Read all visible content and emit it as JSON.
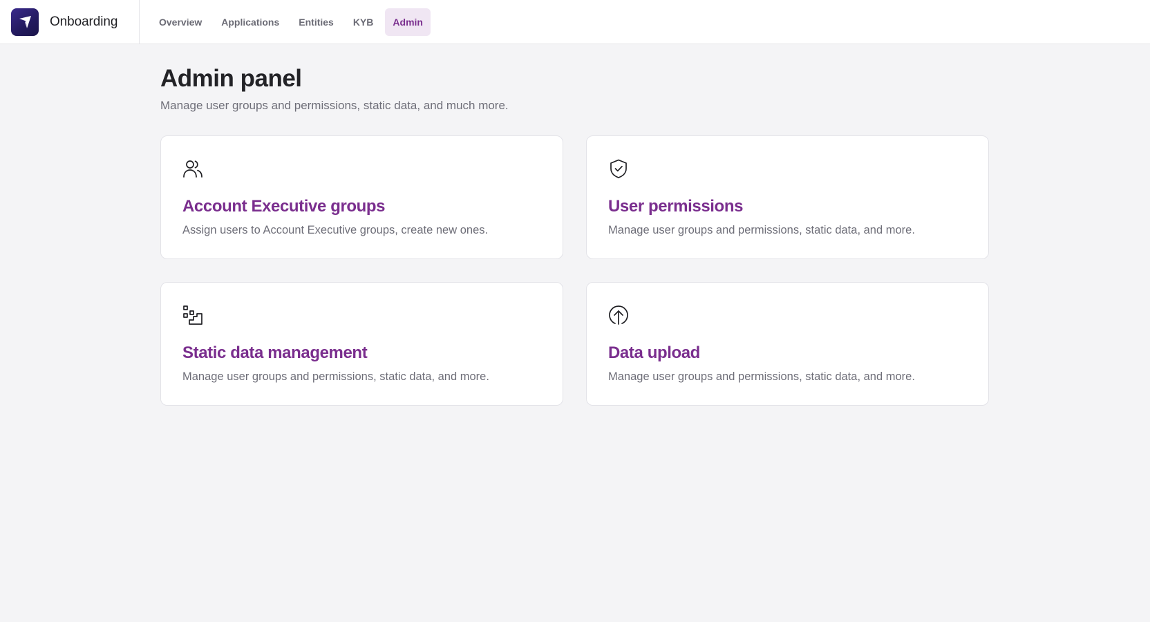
{
  "app": {
    "name": "Onboarding",
    "logo_icon": "paper-plane-icon",
    "logo_color": "#2a1f6e"
  },
  "nav": {
    "tabs": [
      {
        "label": "Overview",
        "active": false
      },
      {
        "label": "Applications",
        "active": false
      },
      {
        "label": "Entities",
        "active": false
      },
      {
        "label": "KYB",
        "active": false
      },
      {
        "label": "Admin",
        "active": true
      }
    ]
  },
  "page": {
    "title": "Admin panel",
    "subtitle": "Manage user groups and permissions, static data, and much more."
  },
  "cards": [
    {
      "icon": "users-icon",
      "title": "Account Executive groups",
      "description": "Assign users to Account Executive groups, create new ones."
    },
    {
      "icon": "shield-check-icon",
      "title": "User permissions",
      "description": "Manage user groups and permissions, static data, and more."
    },
    {
      "icon": "data-steps-icon",
      "title": "Static data management",
      "description": "Manage user groups and permissions, static data, and more."
    },
    {
      "icon": "upload-circle-icon",
      "title": "Data upload",
      "description": "Manage user groups and permissions, static data, and more."
    }
  ],
  "colors": {
    "accent": "#7a2e8e",
    "active_tab_bg": "#f0e6f3",
    "background": "#f4f4f6"
  }
}
